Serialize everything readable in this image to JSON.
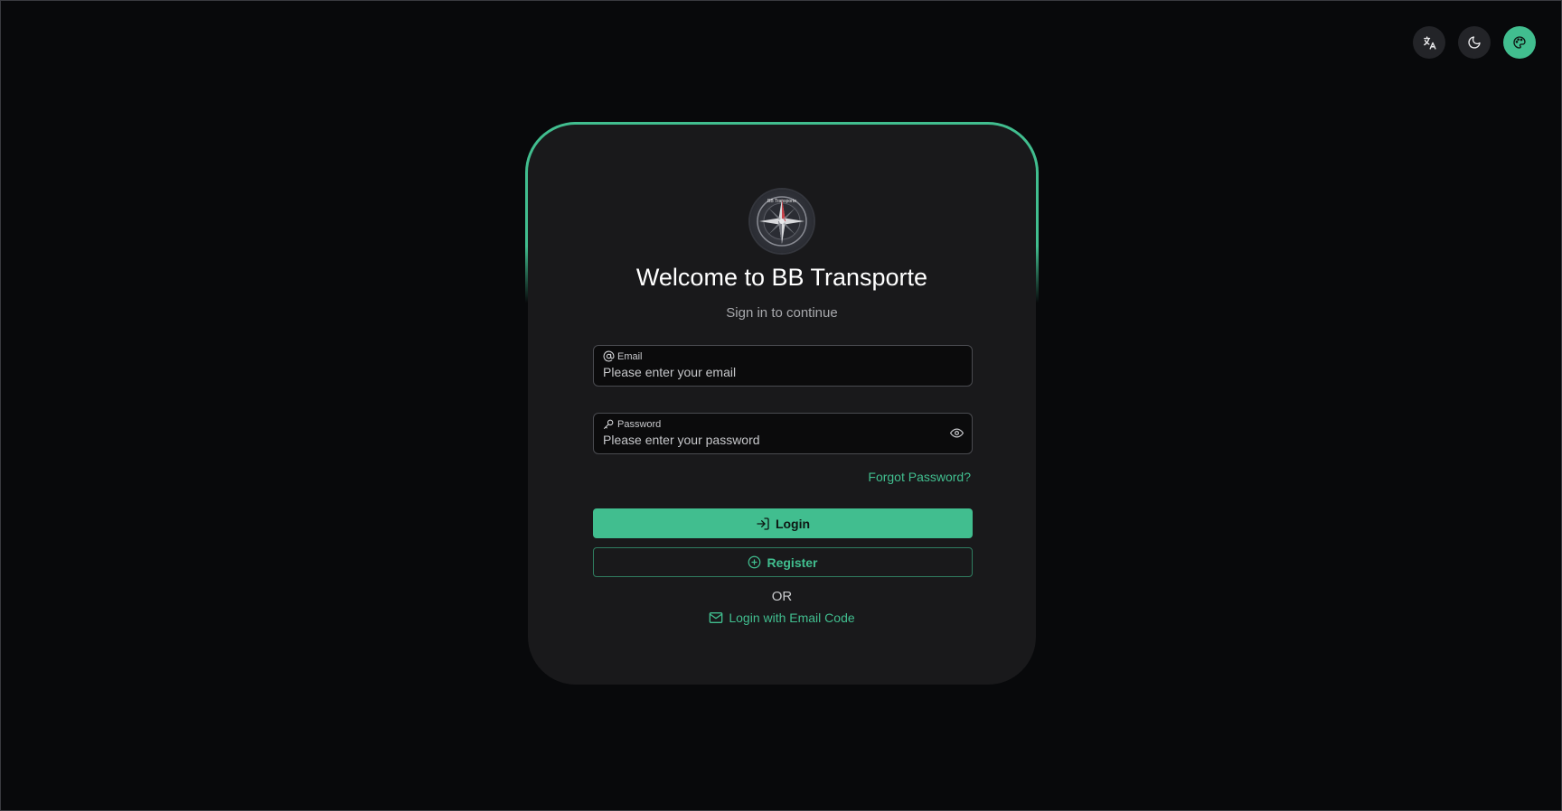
{
  "header": {
    "actions": [
      {
        "name": "translate-icon"
      },
      {
        "name": "moon-icon"
      },
      {
        "name": "palette-icon"
      }
    ]
  },
  "colors": {
    "accent": "#41be8f",
    "background": "#08090b",
    "card": "#19191b"
  },
  "login": {
    "title": "Welcome to BB Transporte",
    "subtitle": "Sign in to continue",
    "email": {
      "label": "Email",
      "placeholder": "Please enter your email",
      "value": ""
    },
    "password": {
      "label": "Password",
      "placeholder": "Please enter your password",
      "value": ""
    },
    "forgot_label": "Forgot Password?",
    "login_label": "Login",
    "register_label": "Register",
    "or_label": "OR",
    "email_code_label": "Login with Email Code"
  },
  "logo": {
    "text": "BB Transporte"
  }
}
